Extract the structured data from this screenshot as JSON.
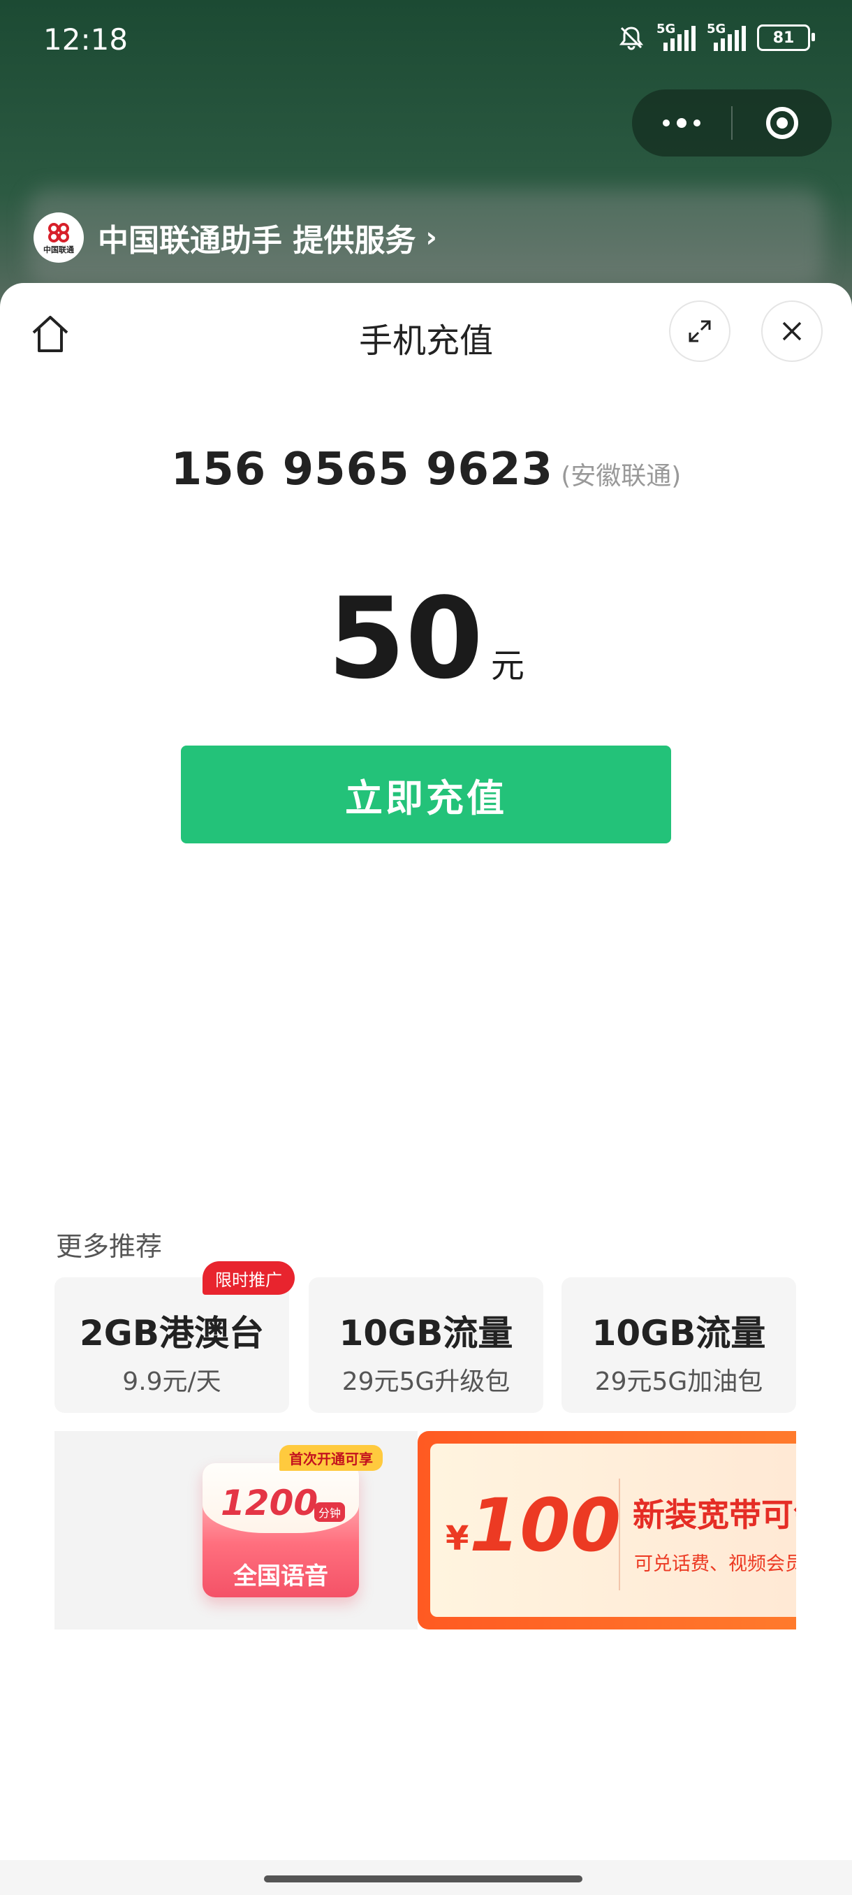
{
  "status_bar": {
    "time": "12:18",
    "signal1_label": "5G",
    "signal2_label": "5G",
    "battery": "81"
  },
  "miniprogram": {
    "provider": "中国联通助手 提供服务",
    "logo_text": "中国联通"
  },
  "page": {
    "title": "手机充值"
  },
  "recharge": {
    "phone": "156 9565 9623",
    "carrier": "(安徽联通)",
    "amount": "50",
    "unit": "元",
    "button": "立即充值"
  },
  "recommend": {
    "label": "更多推荐",
    "badge": "限时推广",
    "cards": [
      {
        "title": "2GB港澳台",
        "sub": "9.9元/天"
      },
      {
        "title": "10GB流量",
        "sub": "29元5G升级包"
      },
      {
        "title": "10GB流量",
        "sub": "29元5G加油包"
      }
    ]
  },
  "banners": {
    "voice": {
      "tag": "首次开通可享",
      "minutes": "1200",
      "unit": "分钟",
      "label": "全国语音"
    },
    "broadband": {
      "currency": "¥",
      "amount": "100",
      "title": "新装宽带可领",
      "sub": "可兑话费、视频会员"
    }
  },
  "colors": {
    "primary": "#23c279",
    "header_bg": "#1c4a33",
    "badge": "#e8242e",
    "broadband_accent": "#ec3a23"
  }
}
